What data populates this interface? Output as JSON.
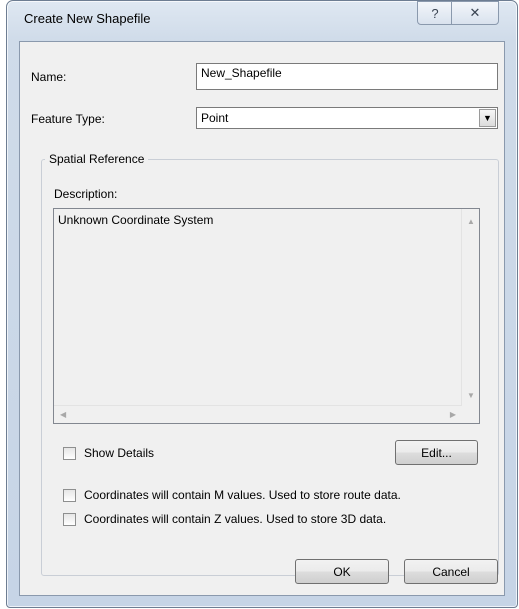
{
  "window": {
    "title": "Create New Shapefile",
    "help_glyph": "?",
    "close_glyph": "✕"
  },
  "form": {
    "name_label": "Name:",
    "name_value": "New_Shapefile",
    "feature_type_label": "Feature Type:",
    "feature_type_value": "Point"
  },
  "spatial_reference": {
    "group_title": "Spatial Reference",
    "description_label": "Description:",
    "description_text": "Unknown Coordinate System",
    "show_details_label": "Show Details",
    "show_details_checked": false,
    "edit_button": "Edit..."
  },
  "options": {
    "m_values_label": "Coordinates will contain M values. Used to store route data.",
    "m_values_checked": false,
    "z_values_label": "Coordinates will contain Z values. Used to store 3D data.",
    "z_values_checked": false
  },
  "buttons": {
    "ok": "OK",
    "cancel": "Cancel"
  }
}
